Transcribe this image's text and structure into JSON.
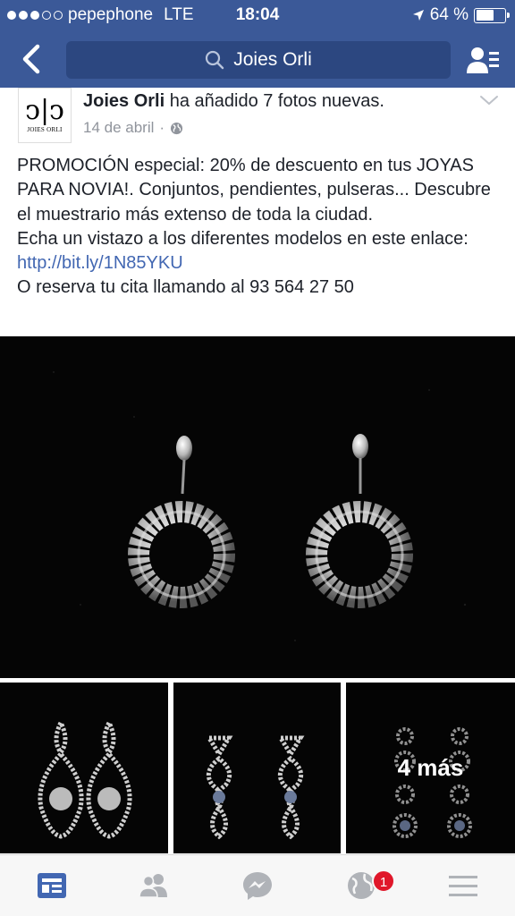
{
  "status_bar": {
    "carrier": "pepephone",
    "network": "LTE",
    "time": "18:04",
    "battery": "64 %",
    "battery_level": 0.64
  },
  "nav": {
    "search_text": "Joies Orli"
  },
  "post": {
    "avatar_monogram": "ↄ|ↄ",
    "avatar_brand": "JOIES ORLI",
    "author": "Joies Orli",
    "action": " ha añadido 7 fotos nuevas.",
    "date": "14 de abril",
    "separator": "·",
    "text_line1": "PROMOCIÓN especial: 20% de descuento en tus JOYAS PARA NOVIA!. Conjuntos, pendientes, pulseras... Descubre el muestrario más extenso de toda la ciudad.",
    "text_line2_prefix": "Echa un vistazo a los diferentes modelos en este enlace: ",
    "link": "http://bit.ly/1N85YKU",
    "text_line3": "O reserva tu cita llamando al 93 564 27 50",
    "more_photos": "4 más"
  },
  "tabbar": {
    "notification_count": "1",
    "icons": [
      "news-feed-icon",
      "friends-icon",
      "messenger-icon",
      "globe-icon",
      "menu-icon"
    ],
    "active_color": "#4267b2",
    "inactive_color": "#b0b3b8"
  },
  "colors": {
    "brand": "#3b5998",
    "link": "#4267b2",
    "badge": "#e0172a"
  }
}
